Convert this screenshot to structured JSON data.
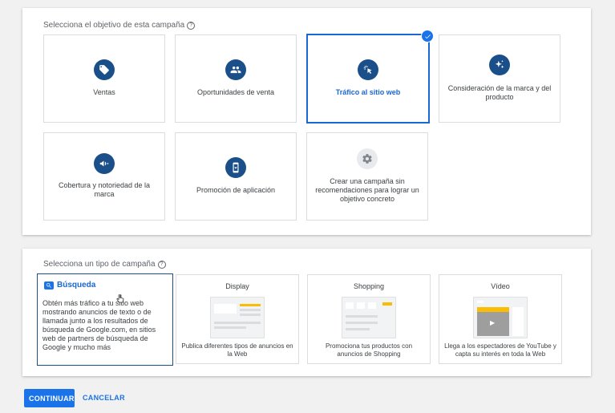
{
  "objective_section": {
    "title": "Selecciona el objetivo de esta campaña",
    "help_icon": "?",
    "cards": [
      {
        "label": "Ventas",
        "icon": "tag-icon"
      },
      {
        "label": "Oportunidades de venta",
        "icon": "people-icon"
      },
      {
        "label": "Tráfico al sitio web",
        "icon": "cursor-click-icon",
        "selected": true
      },
      {
        "label": "Consideración de la marca y del producto",
        "icon": "sparkle-icon"
      },
      {
        "label": "Cobertura y notoriedad de la marca",
        "icon": "megaphone-icon"
      },
      {
        "label": "Promoción de aplicación",
        "icon": "phone-app-icon"
      },
      {
        "label": "Crear una campaña sin recomendaciones para lograr un objetivo concreto",
        "icon": "gear-icon"
      }
    ]
  },
  "type_section": {
    "title": "Selecciona un tipo de campaña",
    "help_icon": "?",
    "cards": [
      {
        "title": "Búsqueda",
        "description": "Obtén más tráfico a tu sitio web mostrando anuncios de texto o de llamada junto a los resultados de búsqueda de Google.com, en sitios web de partners de búsqueda de Google y mucho más",
        "selected": true
      },
      {
        "title": "Display",
        "description": "Publica diferentes tipos de anuncios en la Web"
      },
      {
        "title": "Shopping",
        "description": "Promociona tus productos con anuncios de Shopping"
      },
      {
        "title": "Vídeo",
        "description": "Llega a los espectadores de YouTube y capta su interés en toda la Web"
      }
    ]
  },
  "actions": {
    "continue_label": "CONTINUAR",
    "cancel_label": "CANCELAR"
  },
  "colors": {
    "accent": "#1a73e8",
    "icon_bg": "#1a4f8a",
    "selected_text": "#1967d2"
  }
}
